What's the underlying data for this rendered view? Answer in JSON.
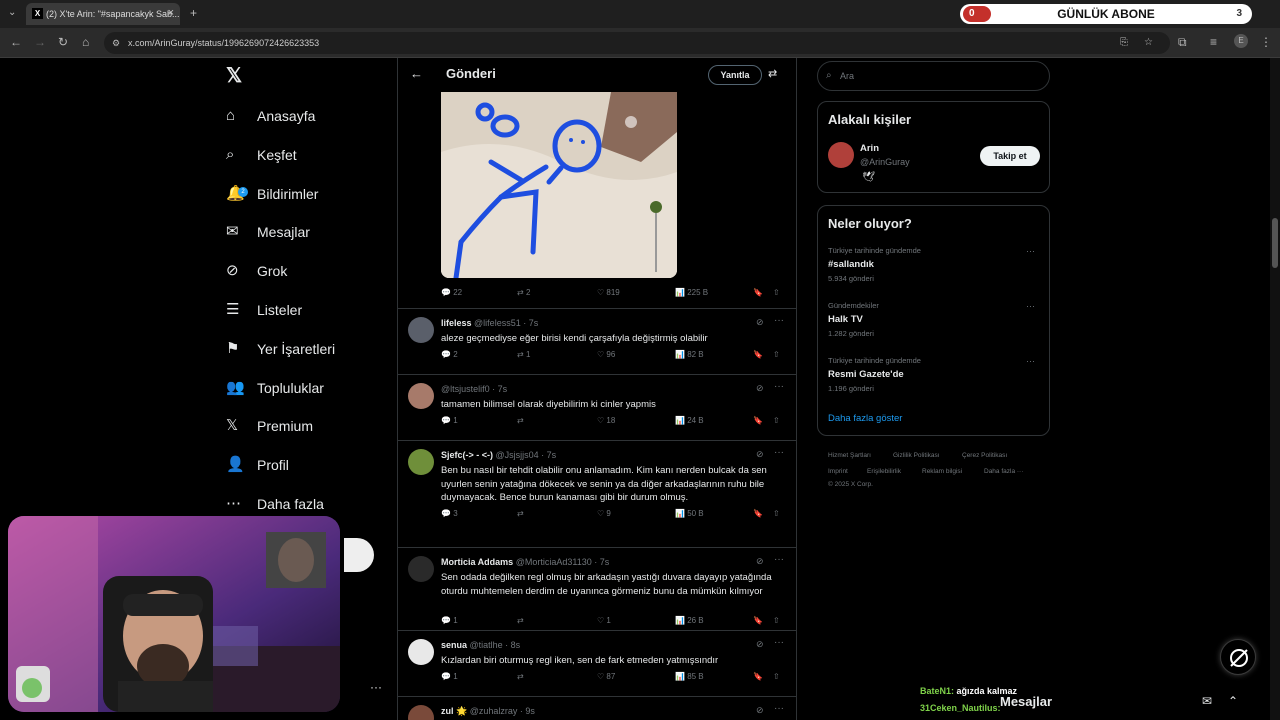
{
  "browser": {
    "tab_title": "(2) X'te Arin: \"#sapancakyk Sab...",
    "url": "x.com/ArinGuray/status/1996269072426623353",
    "overlay_title": "GÜNLÜK ABONE",
    "overlay_left_count": "0",
    "overlay_right_count": "3"
  },
  "nav": {
    "items": [
      {
        "label": "Anasayfa",
        "icon": "home-icon"
      },
      {
        "label": "Keşfet",
        "icon": "search-icon"
      },
      {
        "label": "Bildirimler",
        "icon": "bell-icon",
        "badge": "2"
      },
      {
        "label": "Mesajlar",
        "icon": "mail-icon"
      },
      {
        "label": "Grok",
        "icon": "grok-icon"
      },
      {
        "label": "Listeler",
        "icon": "list-icon"
      },
      {
        "label": "Yer İşaretleri",
        "icon": "bookmark-icon"
      },
      {
        "label": "Topluluklar",
        "icon": "communities-icon"
      },
      {
        "label": "Premium",
        "icon": "x-logo-icon"
      },
      {
        "label": "Profil",
        "icon": "profile-icon"
      },
      {
        "label": "Daha fazla",
        "icon": "more-icon"
      }
    ]
  },
  "header": {
    "title": "Gönderi",
    "reply_label": "Yanıtla"
  },
  "main_post": {
    "replies": "22",
    "reposts": "2",
    "likes": "819",
    "views": "225 B"
  },
  "replies": [
    {
      "name": "lifeless",
      "handle": "@lifeless51 · 7s",
      "text": "aleze geçmediyse eğer birisi kendi çarşafıyla değiştirmiş olabilir",
      "replies": "2",
      "reposts": "1",
      "likes": "96",
      "views": "82 B",
      "avatar_color": "#5a5f6a"
    },
    {
      "name": "",
      "handle": "@ltsjustelif0 · 7s",
      "text": "tamamen bilimsel olarak diyebilirim ki cinler yapmis",
      "replies": "1",
      "reposts": "",
      "likes": "18",
      "views": "24 B",
      "avatar_color": "#a77a6a"
    },
    {
      "name": "Sjefc(-> - <-)",
      "handle": "@Jsjsjjs04 · 7s",
      "text": "Ben bu nasıl bir tehdit olabilir onu anlamadım. Kim kanı nerden bulcak da sen uyurlen senin yatağına dökecek ve senin ya da diğer arkadaşlarının ruhu bile duymayacak. Bence burun kanaması gibi bir durum olmuş.",
      "replies": "3",
      "reposts": "",
      "likes": "9",
      "views": "50 B",
      "avatar_color": "#6f8f3a"
    },
    {
      "name": "Morticia Addams",
      "handle": "@MorticiaAd31130 · 7s",
      "text": "Sen odada değilken regl olmuş bir arkadaşın yastığı duvara dayayıp yatağında oturdu muhtemelen derdim de uyanınca görmeniz bunu da mümkün kılmıyor",
      "replies": "1",
      "reposts": "",
      "likes": "1",
      "views": "26 B",
      "avatar_color": "#2a2a2a"
    },
    {
      "name": "senua",
      "handle": "@tiatlhe · 8s",
      "text": "Kızlardan biri oturmuş regl iken, sen de fark etmeden yatmışsındır",
      "replies": "1",
      "reposts": "",
      "likes": "87",
      "views": "85 B",
      "avatar_color": "#e8e8e8"
    },
    {
      "name": "zul 🌟",
      "handle": "@zuhalzray · 9s",
      "text": "",
      "replies": "",
      "reposts": "",
      "likes": "",
      "views": "",
      "avatar_color": "#7a4a3a"
    }
  ],
  "right": {
    "search_placeholder": "Ara",
    "relevant_title": "Alakalı kişiler",
    "person_name": "Arin",
    "person_handle": "@ArinGuray",
    "follow_label": "Takip et",
    "trending_title": "Neler oluyor?",
    "trends": [
      {
        "meta": "Türkiye tarihinde gündemde",
        "name": "#sallandık",
        "count": "5.934 gönderi"
      },
      {
        "meta": "Gündemdekiler",
        "name": "Halk TV",
        "count": "1.282 gönderi"
      },
      {
        "meta": "Türkiye tarihinde gündemde",
        "name": "Resmi Gazete'de",
        "count": "1.196 gönderi"
      }
    ],
    "show_more": "Daha fazla göster",
    "footer": [
      "Hizmet Şartları",
      "Gizlilik Politikası",
      "Çerez Politikası",
      "Imprint",
      "Erişilebilirlik",
      "Reklam bilgisi",
      "Daha fazla ···",
      "© 2025 X Corp."
    ]
  },
  "chat": [
    {
      "user": "BateN1:",
      "text": "ağızda kalmaz",
      "color": "#7fd24a"
    },
    {
      "user": "31Ceken_Nautilus:",
      "text": "",
      "color": "#7fd24a"
    }
  ],
  "messages_label": "Mesajlar",
  "colors": {
    "accent": "#1d9bf0",
    "border": "#2f3336",
    "muted": "#71767b"
  }
}
